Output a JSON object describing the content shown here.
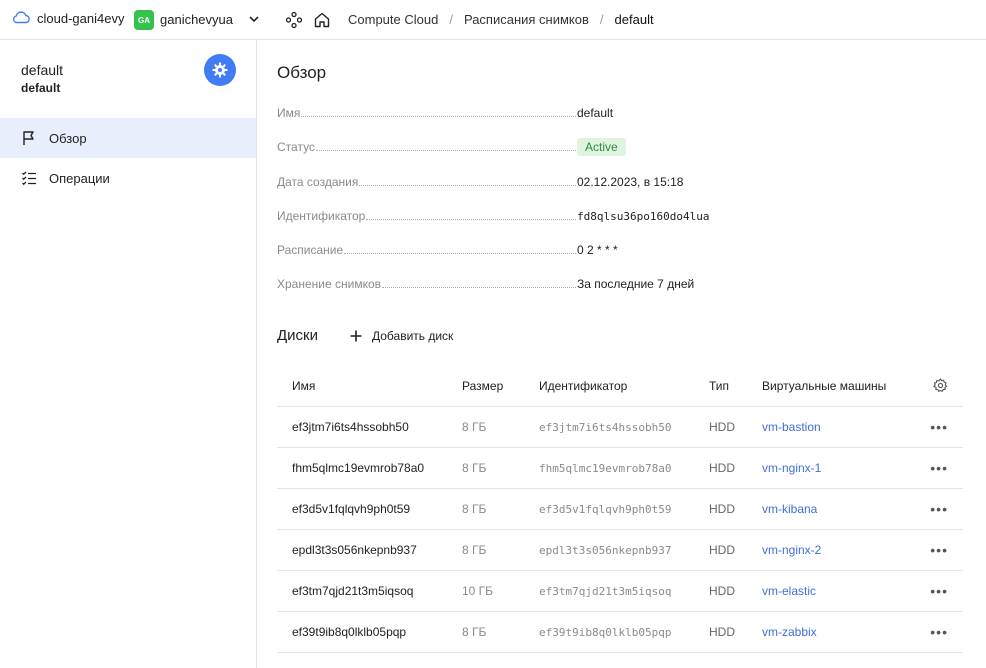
{
  "topbar": {
    "cloud_name": "cloud-gani4evy",
    "folder_badge": "GA",
    "folder_name": "ganichevyua",
    "breadcrumbs": [
      "Compute Cloud",
      "Расписания снимков",
      "default"
    ],
    "separator": "/",
    "badge_color": "#34c24a"
  },
  "sidebar": {
    "title": "default",
    "subtitle": "default",
    "accent_color": "#3f7cf5",
    "items": [
      {
        "label": "Обзор",
        "icon": "flag-icon",
        "active": true
      },
      {
        "label": "Операции",
        "icon": "list-check-icon",
        "active": false
      }
    ]
  },
  "overview": {
    "heading": "Обзор",
    "props": [
      {
        "key": "Имя",
        "value": "default"
      },
      {
        "key": "Статус",
        "value": "Active"
      },
      {
        "key": "Дата создания",
        "value": "02.12.2023, в 15:18"
      },
      {
        "key": "Идентификатор",
        "value": "fd8qlsu36po160do4lua"
      },
      {
        "key": "Расписание",
        "value": "0 2 * * *"
      },
      {
        "key": "Хранение снимков",
        "value": "За последние 7 дней"
      }
    ],
    "status_color": "#2e8b3e"
  },
  "disks": {
    "heading": "Диски",
    "add_label": "Добавить диск",
    "columns": [
      "Имя",
      "Размер",
      "Идентификатор",
      "Тип",
      "Виртуальные машины"
    ],
    "rows": [
      {
        "name": "ef3jtm7i6ts4hssobh50",
        "size": "8 ГБ",
        "id": "ef3jtm7i6ts4hssobh50",
        "type": "HDD",
        "vm": "vm-bastion"
      },
      {
        "name": "fhm5qlmc19evmrob78a0",
        "size": "8 ГБ",
        "id": "fhm5qlmc19evmrob78a0",
        "type": "HDD",
        "vm": "vm-nginx-1"
      },
      {
        "name": "ef3d5v1fqlqvh9ph0t59",
        "size": "8 ГБ",
        "id": "ef3d5v1fqlqvh9ph0t59",
        "type": "HDD",
        "vm": "vm-kibana"
      },
      {
        "name": "epdl3t3s056nkepnb937",
        "size": "8 ГБ",
        "id": "epdl3t3s056nkepnb937",
        "type": "HDD",
        "vm": "vm-nginx-2"
      },
      {
        "name": "ef3tm7qjd21t3m5iqsoq",
        "size": "10 ГБ",
        "id": "ef3tm7qjd21t3m5iqsoq",
        "type": "HDD",
        "vm": "vm-elastic"
      },
      {
        "name": "ef39t9ib8q0lklb05pqp",
        "size": "8 ГБ",
        "id": "ef39t9ib8q0lklb05pqp",
        "type": "HDD",
        "vm": "vm-zabbix"
      }
    ],
    "link_color": "#3f6fd8"
  }
}
